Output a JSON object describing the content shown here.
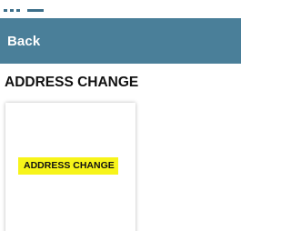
{
  "header": {
    "back_label": "Back",
    "bar_color": "#4a7f99"
  },
  "section": {
    "heading": "ADDRESS CHANGE"
  },
  "card": {
    "tag_label": "ADDRESS CHANGE",
    "tag_color": "#f7f41a"
  },
  "icons": {
    "menu": "menu-icon"
  }
}
